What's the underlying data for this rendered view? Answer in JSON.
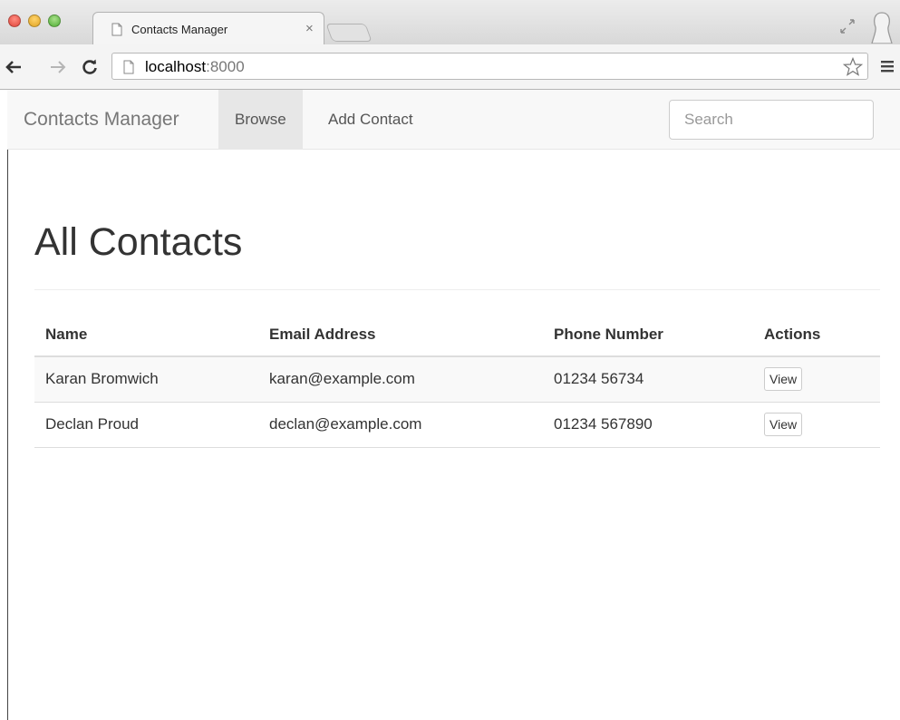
{
  "browser": {
    "tab_title": "Contacts Manager",
    "tab_close": "×",
    "url_host": "localhost",
    "url_port": ":8000"
  },
  "navbar": {
    "brand": "Contacts Manager",
    "links": [
      {
        "label": "Browse",
        "active": true
      },
      {
        "label": "Add Contact",
        "active": false
      }
    ],
    "search_placeholder": "Search"
  },
  "main": {
    "title": "All Contacts",
    "table": {
      "headers": [
        "Name",
        "Email Address",
        "Phone Number",
        "Actions"
      ],
      "rows": [
        {
          "name": "Karan Bromwich",
          "email": "karan@example.com",
          "phone": "01234 56734",
          "action": "View"
        },
        {
          "name": "Declan Proud",
          "email": "declan@example.com",
          "phone": "01234 567890",
          "action": "View"
        }
      ]
    }
  }
}
